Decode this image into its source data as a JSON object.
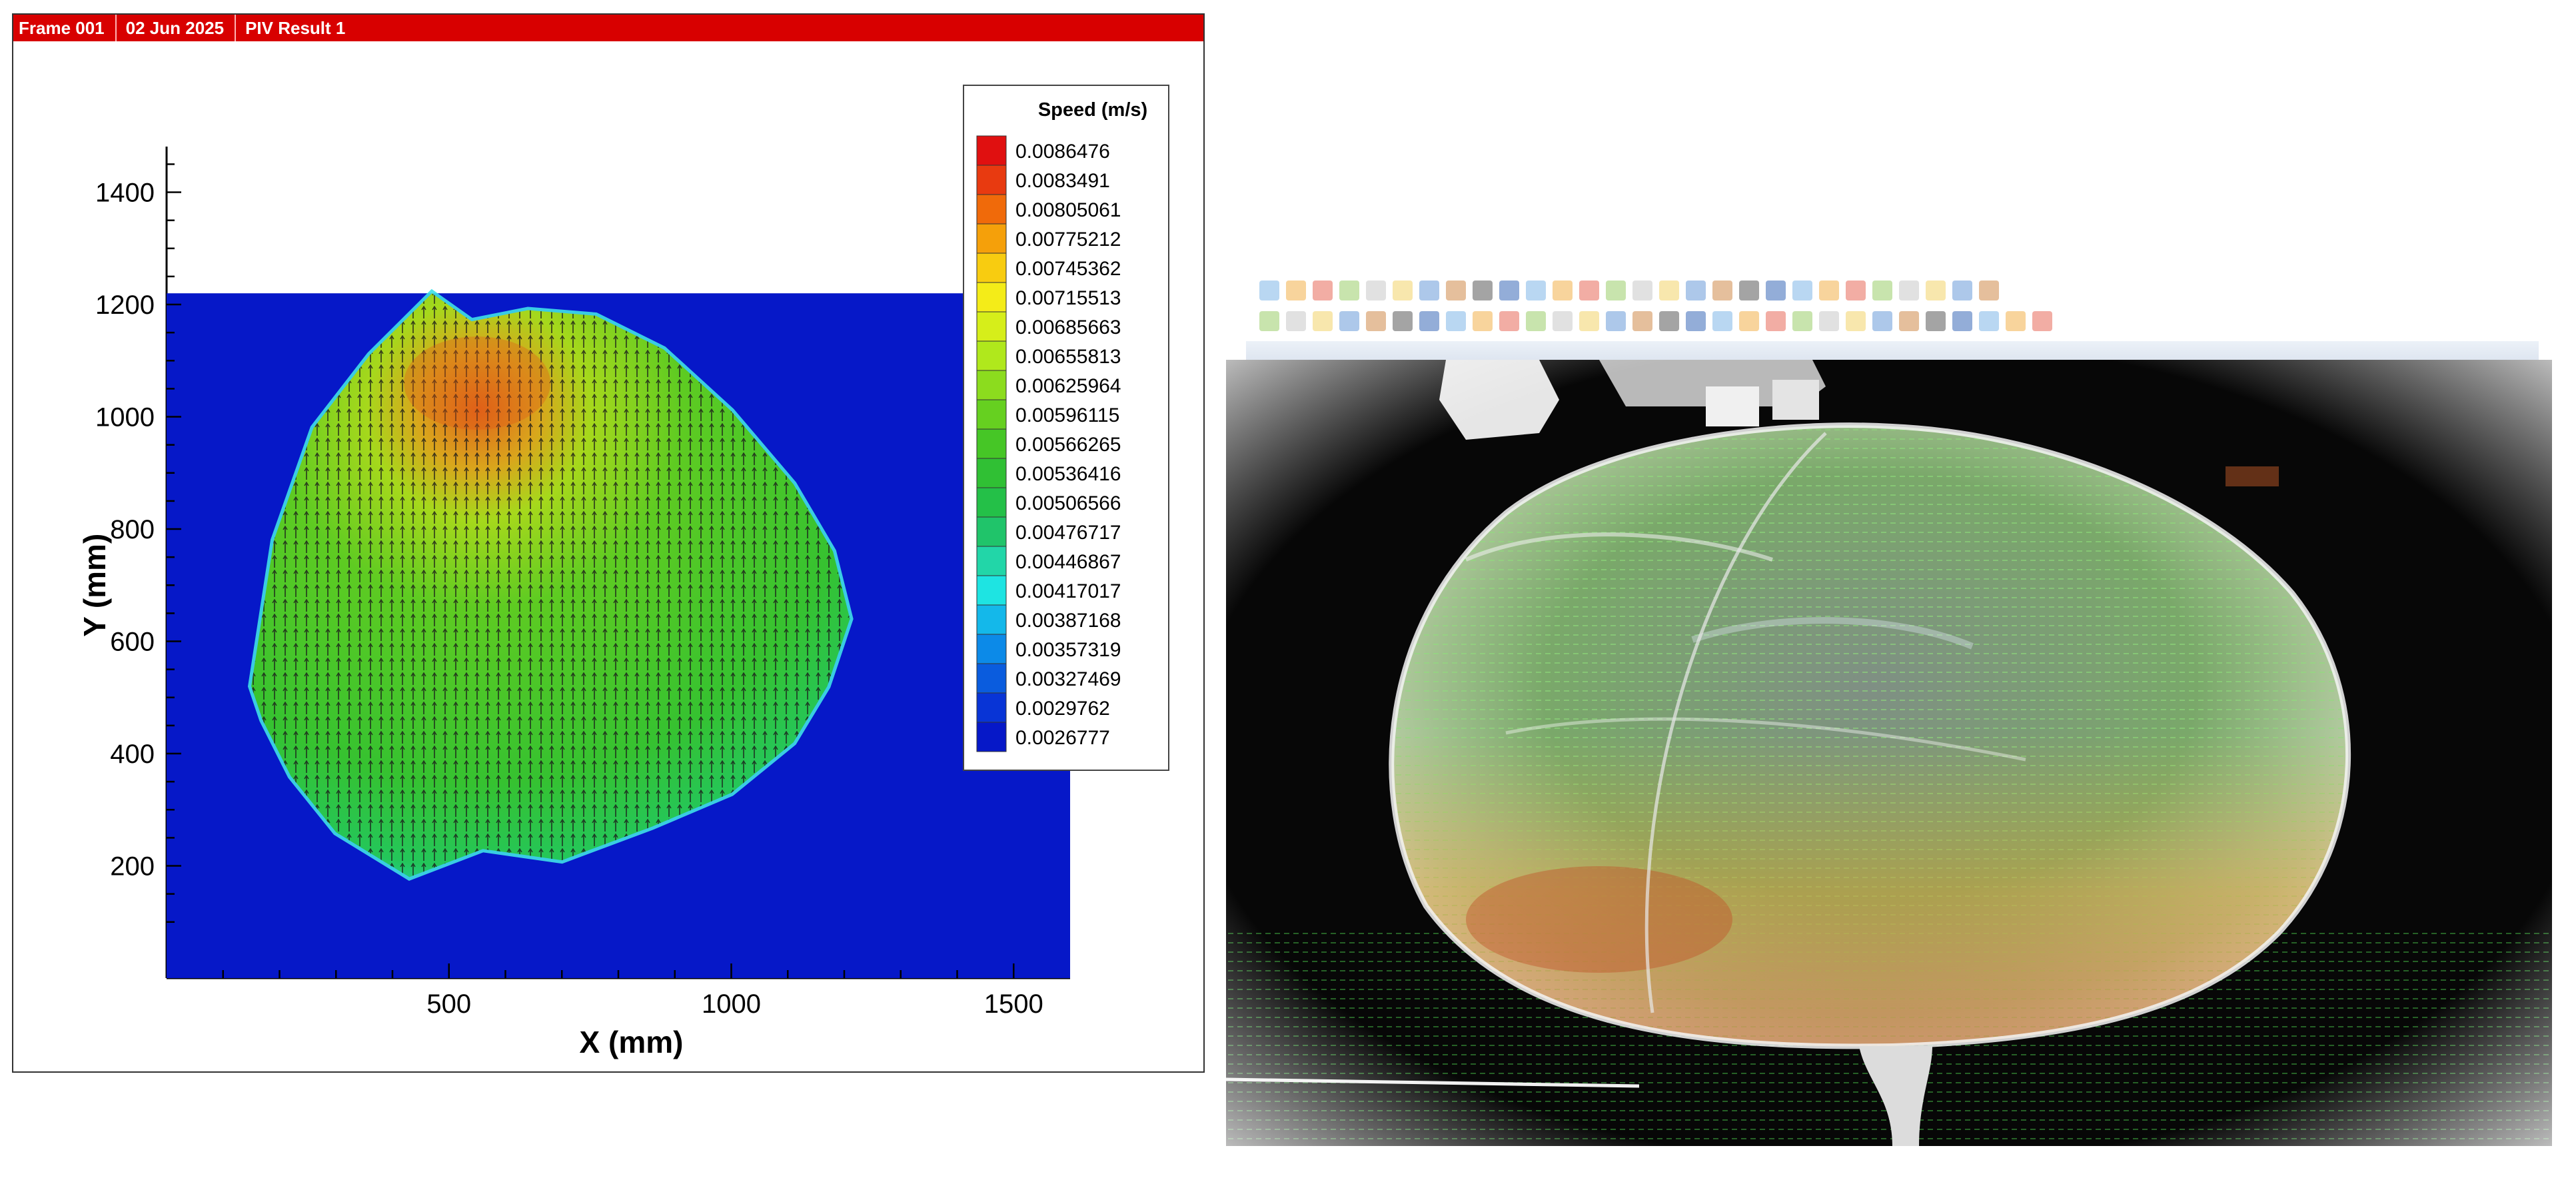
{
  "window": {
    "title_segments": [
      "Frame 001",
      "02 Jun 2025",
      "PIV Result  1"
    ]
  },
  "legend": {
    "title": "Speed (m/s)",
    "levels": [
      "0.0086476",
      "0.0083491",
      "0.00805061",
      "0.00775212",
      "0.00745362",
      "0.00715513",
      "0.00685663",
      "0.00655813",
      "0.00625964",
      "0.00596115",
      "0.00566265",
      "0.00536416",
      "0.00506566",
      "0.00476717",
      "0.00446867",
      "0.00417017",
      "0.00387168",
      "0.00357319",
      "0.00327469",
      "0.0029762",
      "0.0026777"
    ],
    "colors": [
      "#e01010",
      "#e83a10",
      "#f06a0a",
      "#f5a00a",
      "#f8cc10",
      "#f4ec18",
      "#d6ee1a",
      "#b0e81c",
      "#8cdc1e",
      "#66d020",
      "#46c626",
      "#30c034",
      "#24c048",
      "#20c46a",
      "#22d6a8",
      "#1ee4e2",
      "#14b8ea",
      "#0c8ae8",
      "#0a5cde",
      "#0834d6",
      "#0618c8"
    ]
  },
  "chart_data": [
    {
      "type": "heatmap",
      "title": "",
      "xlabel": "X (mm)",
      "ylabel": "Y (mm)",
      "xlim": [
        0,
        1600
      ],
      "ylim": [
        0,
        1460
      ],
      "xticks": [
        500,
        1000,
        1500
      ],
      "yticks": [
        200,
        400,
        600,
        800,
        1000,
        1200,
        1400
      ],
      "colorbar_title": "Speed (m/s)",
      "colorbar_min": 0.0026777,
      "colorbar_max": 0.0086476,
      "background_speed": 0.0026777,
      "data_region_top_y": 1220,
      "region": {
        "x_range": [
          90,
          1200
        ],
        "y_range": [
          175,
          1245
        ],
        "peak_speed_location": [
          550,
          1060
        ],
        "peak_speed": 0.0083491,
        "typical_speed": 0.0059
      },
      "vectors": "velocity vector arrows over data region"
    }
  ],
  "right_image": {
    "description_label": "",
    "background_color": "#070707"
  }
}
